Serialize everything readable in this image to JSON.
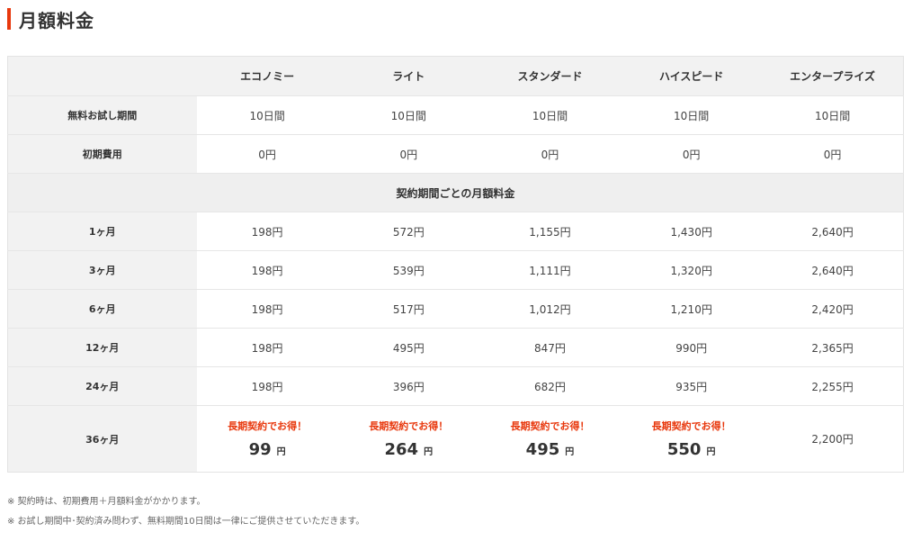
{
  "heading": {
    "title": "月額料金",
    "accent_color": "#e8380d"
  },
  "table": {
    "columns": [
      "エコノミー",
      "ライト",
      "スタンダード",
      "ハイスピード",
      "エンタープライズ"
    ],
    "rows_top": [
      {
        "label": "無料お試し期間",
        "values": [
          "10日間",
          "10日間",
          "10日間",
          "10日間",
          "10日間"
        ]
      },
      {
        "label": "初期費用",
        "values": [
          "0円",
          "0円",
          "0円",
          "0円",
          "0円"
        ]
      }
    ],
    "section_label": "契約期間ごとの月額料金",
    "rows_monthly": [
      {
        "label": "1ヶ月",
        "values": [
          "198円",
          "572円",
          "1,155円",
          "1,430円",
          "2,640円"
        ]
      },
      {
        "label": "3ヶ月",
        "values": [
          "198円",
          "539円",
          "1,111円",
          "1,320円",
          "2,640円"
        ]
      },
      {
        "label": "6ヶ月",
        "values": [
          "198円",
          "517円",
          "1,012円",
          "1,210円",
          "2,420円"
        ]
      },
      {
        "label": "12ヶ月",
        "values": [
          "198円",
          "495円",
          "847円",
          "990円",
          "2,365円"
        ]
      },
      {
        "label": "24ヶ月",
        "values": [
          "198円",
          "396円",
          "682円",
          "935円",
          "2,255円"
        ]
      }
    ],
    "row_36": {
      "label": "36ヶ月",
      "promo_text": "長期契約でお得！",
      "unit": "円",
      "prices": [
        "99",
        "264",
        "495",
        "550"
      ],
      "enterprise": "2,200円"
    }
  },
  "notes": [
    "※ 契約時は、初期費用＋月額料金がかかります。",
    "※ お試し期間中･契約済み問わず、無料期間10日間は一律にご提供させていただきます。"
  ]
}
